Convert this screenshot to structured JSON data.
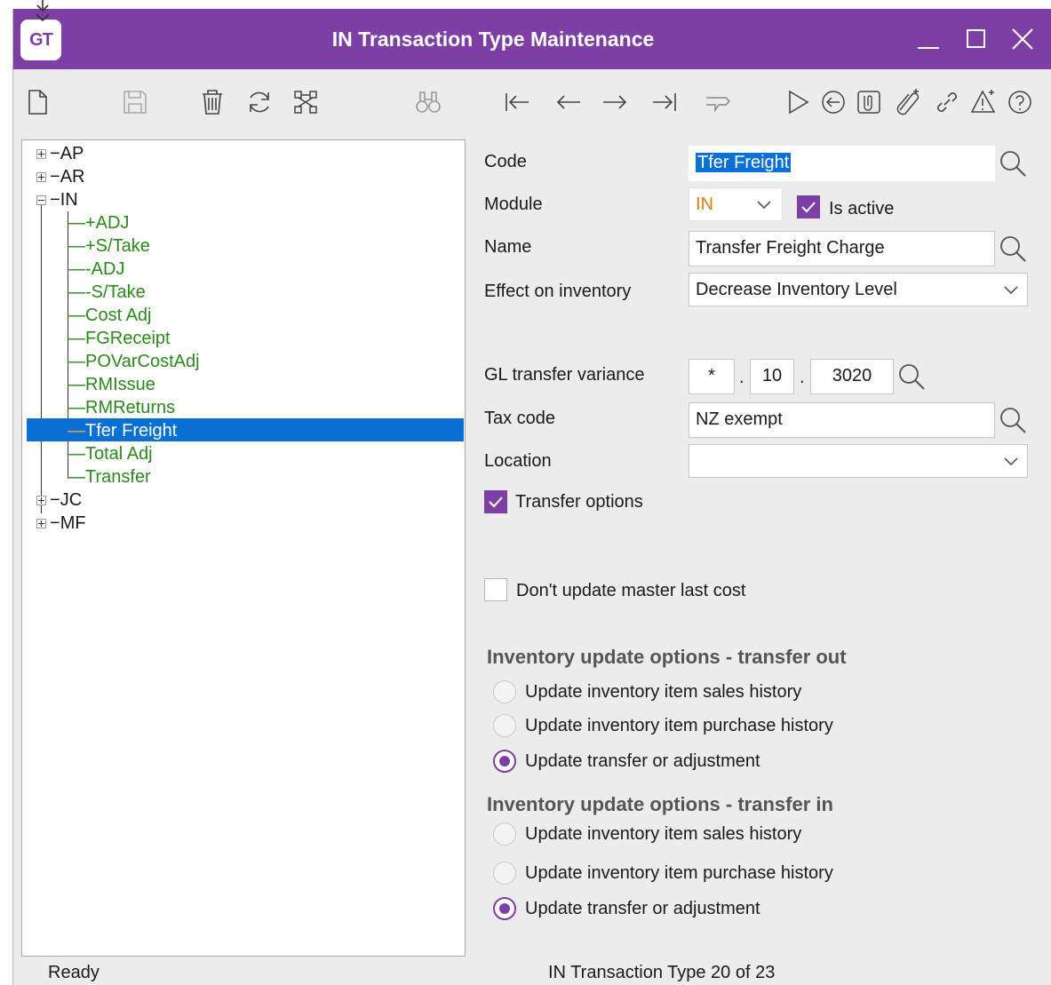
{
  "window": {
    "title": "IN Transaction Type Maintenance",
    "logo": "GT"
  },
  "toolbar": {
    "icons": [
      "new-icon",
      "save-icon",
      "delete-icon",
      "refresh-icon",
      "structure-icon",
      "find-icon",
      "first-icon",
      "previous-icon",
      "next-icon",
      "last-icon",
      "drilldown-icon",
      "run-icon",
      "back-icon",
      "document-icon",
      "attach-icon",
      "link-icon",
      "alert-icon",
      "help-icon"
    ]
  },
  "tree": {
    "roots": [
      "AP",
      "AR",
      "IN",
      "JC",
      "MF"
    ],
    "in_children": [
      "+ADJ",
      "+S/Take",
      "-ADJ",
      "-S/Take",
      "Cost Adj",
      "FGReceipt",
      "POVarCostAdj",
      "RMIssue",
      "RMReturns",
      "Tfer Freight",
      "Total Adj",
      "Transfer"
    ],
    "selected": "Tfer Freight"
  },
  "form": {
    "code_label": "Code",
    "code_value": "Tfer Freight",
    "module_label": "Module",
    "module_value": "IN",
    "is_active_label": "Is active",
    "name_label": "Name",
    "name_value": "Transfer Freight Charge",
    "effect_label": "Effect on inventory",
    "effect_value": "Decrease Inventory Level",
    "gl_label": "GL transfer variance",
    "gl_seg1": "*",
    "gl_seg2": "10",
    "gl_seg3": "3020",
    "tax_label": "Tax code",
    "tax_value": "NZ exempt",
    "location_label": "Location",
    "location_value": "",
    "transfer_options_label": "Transfer options",
    "dont_update_label": "Don't update master last cost",
    "out_section": "Inventory update options - transfer out",
    "in_section": "Inventory update options - transfer in",
    "opt_sales": "Update inventory item sales history",
    "opt_purchase": "Update inventory item purchase history",
    "opt_transfer": "Update transfer or adjustment",
    "colors": {
      "accent": "#7d3fa6",
      "module_text": "#e07a10",
      "selection": "#0a70d6",
      "leaf_text": "#2a8a1a"
    }
  },
  "status": {
    "left": "Ready",
    "record": "IN Transaction Type 20 of 23"
  }
}
